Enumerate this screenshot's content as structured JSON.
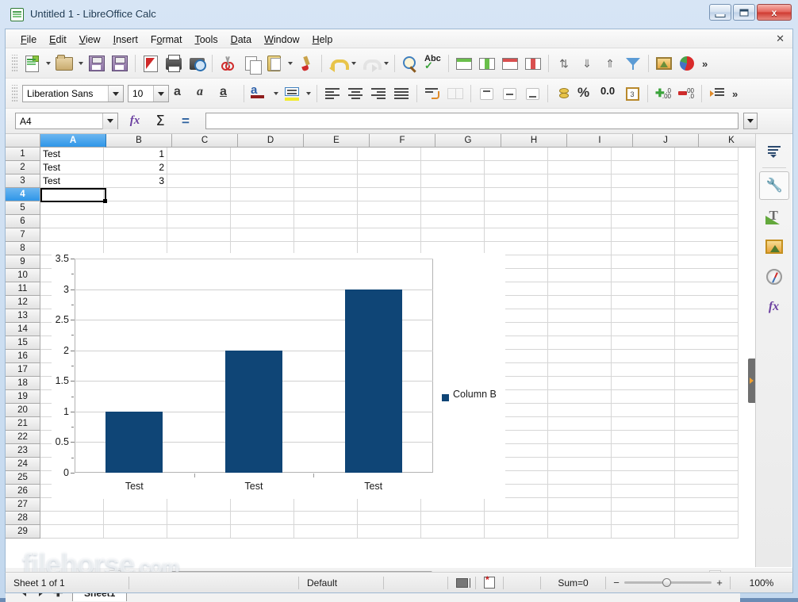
{
  "window": {
    "title": "Untitled 1 - LibreOffice Calc",
    "app_icon": "calc-document-icon",
    "minimize_label": "Minimize",
    "maximize_label": "Maximize",
    "close_label": "x"
  },
  "menu": {
    "items": [
      "File",
      "Edit",
      "View",
      "Insert",
      "Format",
      "Tools",
      "Data",
      "Window",
      "Help"
    ],
    "close_document": "✕"
  },
  "standard_toolbar": {
    "overflow": "»",
    "buttons": [
      {
        "name": "new-document",
        "icon": "new-document-icon"
      },
      {
        "name": "open-document",
        "icon": "open-folder-icon"
      },
      {
        "name": "save-document",
        "icon": "floppy-save-icon"
      },
      {
        "name": "export-pdf",
        "icon": "pdf-export-icon"
      },
      {
        "name": "print-file",
        "icon": "printer-icon"
      },
      {
        "name": "print-preview",
        "icon": "print-preview-icon"
      },
      {
        "name": "cut",
        "icon": "scissors-icon"
      },
      {
        "name": "copy",
        "icon": "copy-icon"
      },
      {
        "name": "paste",
        "icon": "clipboard-icon"
      },
      {
        "name": "clone-formatting",
        "icon": "paintbrush-icon"
      },
      {
        "name": "undo",
        "icon": "undo-arrow-icon"
      },
      {
        "name": "redo",
        "icon": "redo-arrow-icon"
      },
      {
        "name": "find-and-replace",
        "icon": "magnifier-icon"
      },
      {
        "name": "spelling",
        "icon": "abc-check-icon"
      },
      {
        "name": "insert-row-above",
        "icon": "table-row-green-icon"
      },
      {
        "name": "insert-column-before",
        "icon": "table-column-green-icon"
      },
      {
        "name": "delete-rows",
        "icon": "table-row-red-icon"
      },
      {
        "name": "delete-columns",
        "icon": "table-column-red-icon"
      },
      {
        "name": "sort",
        "icon": "sort-updown-icon"
      },
      {
        "name": "sort-ascending",
        "icon": "sort-ascending-icon"
      },
      {
        "name": "sort-descending",
        "icon": "sort-descending-icon"
      },
      {
        "name": "autofilter",
        "icon": "funnel-icon"
      },
      {
        "name": "insert-image",
        "icon": "image-icon"
      },
      {
        "name": "insert-chart",
        "icon": "pie-chart-icon"
      }
    ]
  },
  "formatting_toolbar": {
    "font_name": "Liberation Sans",
    "font_size": "10",
    "overflow": "»",
    "bold": "a",
    "italic": "a",
    "underline": "a",
    "font_color": "a",
    "font_color_swatch": "#8f1d1d",
    "highlight_swatch": "#f2ea2c",
    "percent": "%",
    "number_format": "0.0",
    "date_icon_day": "3"
  },
  "formula_bar": {
    "name_box_value": "A4",
    "function_wizard": "fx",
    "sum": "Σ",
    "formula": "=",
    "input_value": "",
    "input_placeholder": ""
  },
  "sheet": {
    "columns": [
      "A",
      "B",
      "C",
      "D",
      "E",
      "F",
      "G",
      "H",
      "I",
      "J",
      "K"
    ],
    "selected_column": "A",
    "rows": [
      1,
      2,
      3,
      4,
      5,
      6,
      7,
      8,
      9,
      10,
      11,
      12,
      13,
      14,
      15,
      16,
      17,
      18,
      19,
      20,
      21,
      22,
      23,
      24,
      25,
      26,
      27,
      28,
      29
    ],
    "selected_row": 4,
    "active_cell": "A4",
    "data": [
      {
        "row": 1,
        "A": "Test",
        "B": "1"
      },
      {
        "row": 2,
        "A": "Test",
        "B": "2"
      },
      {
        "row": 3,
        "A": "Test",
        "B": "3"
      }
    ]
  },
  "chart_data": {
    "type": "bar",
    "title": "",
    "xlabel": "",
    "ylabel": "",
    "categories": [
      "Test",
      "Test",
      "Test"
    ],
    "values": [
      1,
      2,
      3
    ],
    "series": [
      {
        "name": "Column B",
        "values": [
          1,
          2,
          3
        ],
        "color": "#0f4576"
      }
    ],
    "ylim": [
      0,
      3.5
    ],
    "yticks": [
      "0",
      "0.5",
      "1",
      "1.5",
      "2",
      "2.5",
      "3",
      "3.5"
    ],
    "ytick_values": [
      0,
      0.5,
      1,
      1.5,
      2,
      2.5,
      3,
      3.5
    ],
    "grid": true,
    "legend_position": "right",
    "legend_entries": [
      "Column B"
    ]
  },
  "tab_bar": {
    "first_sheet": "first-sheet",
    "prev_sheet": "previous-sheet",
    "next_sheet": "next-sheet",
    "add_sheet": "✚",
    "sheets": [
      "Sheet1"
    ],
    "active_sheet": "Sheet1"
  },
  "status_bar": {
    "sheet_count": "Sheet 1 of 1",
    "page_style": "Default",
    "selection_mode_icon": "selection-mode-icon",
    "modified_icon": "document-modified-icon",
    "sum": "Sum=0",
    "zoom_minus": "−",
    "zoom_plus": "+",
    "zoom_level": "100%"
  },
  "sidebar": {
    "items": [
      {
        "name": "sidebar-settings",
        "icon": "hamburger-menu-icon"
      },
      {
        "name": "sidebar-properties",
        "icon": "wrench-icon"
      },
      {
        "name": "sidebar-styles",
        "icon": "styles-t-icon"
      },
      {
        "name": "sidebar-gallery",
        "icon": "gallery-image-icon"
      },
      {
        "name": "sidebar-navigator",
        "icon": "compass-icon"
      },
      {
        "name": "sidebar-functions",
        "icon": "functions-fx-icon"
      }
    ],
    "hide_handle": "sidebar-hide-handle"
  },
  "watermark": {
    "text": "filehorse",
    "suffix": ".com"
  }
}
